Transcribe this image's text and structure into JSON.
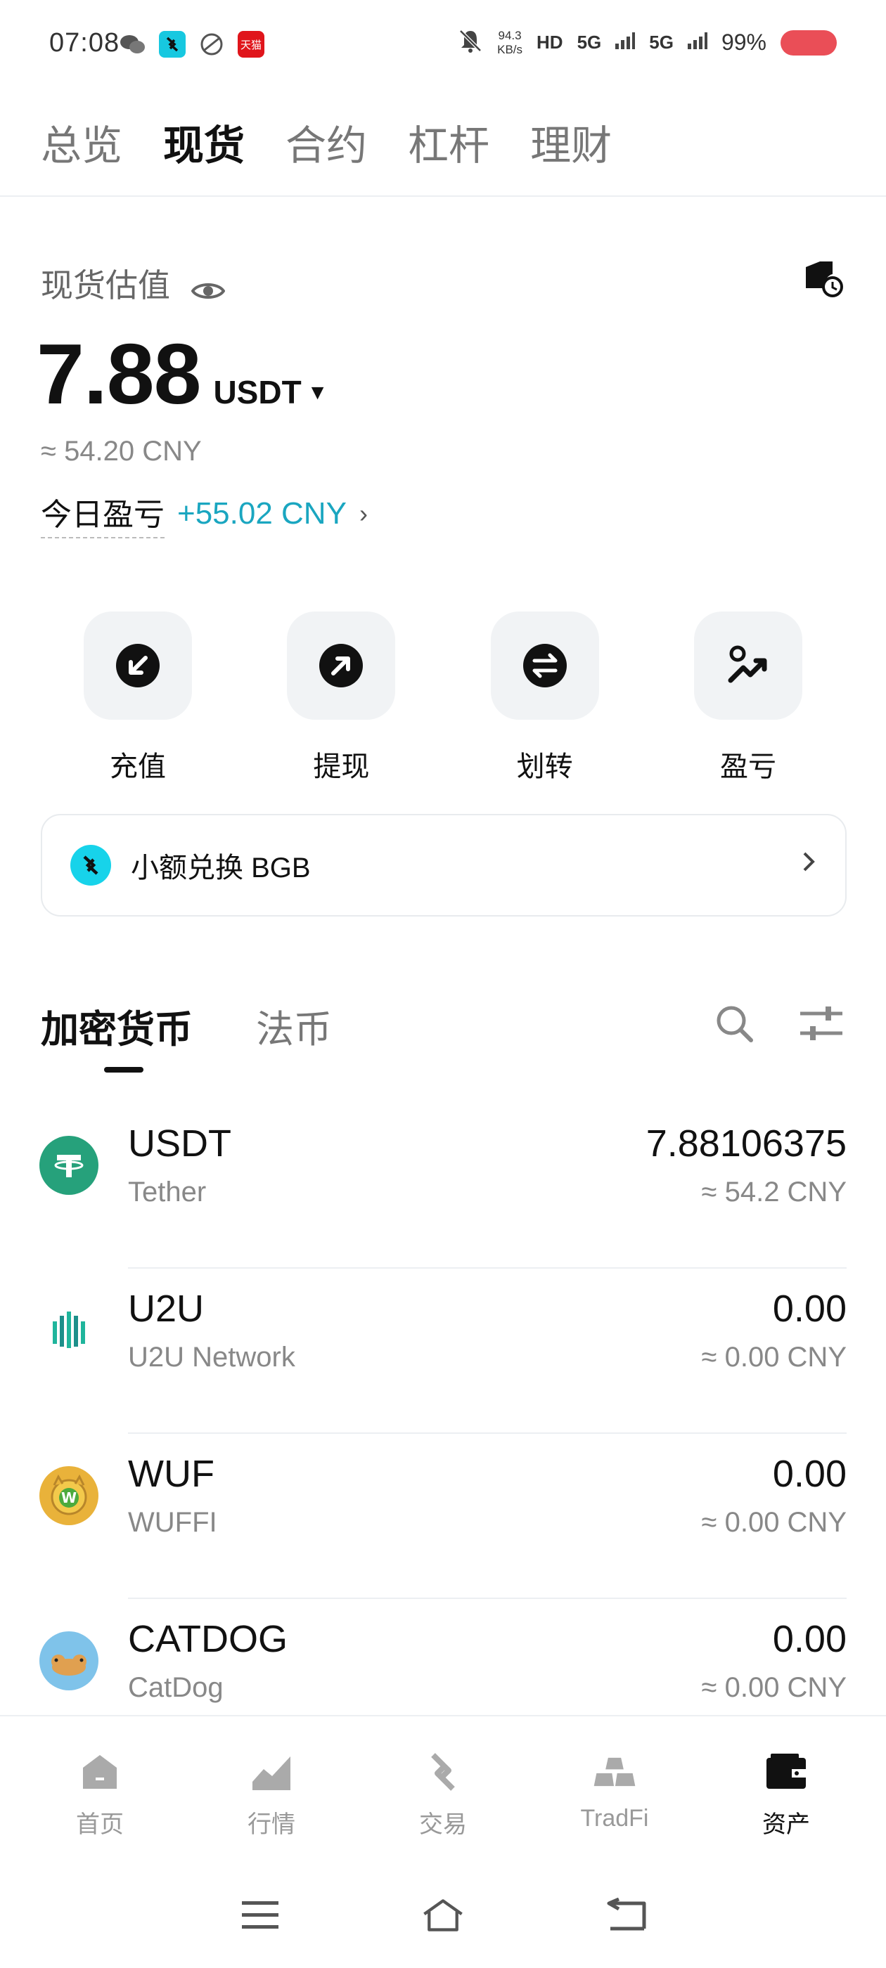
{
  "status_bar": {
    "time": "07:08",
    "net_speed_value": "94.3",
    "net_speed_unit": "KB/s",
    "hd": "HD",
    "signal1": "5G",
    "signal2": "5G",
    "battery": "99%",
    "tmall_label": "天猫"
  },
  "top_tabs": [
    {
      "label": "总览"
    },
    {
      "label": "现货"
    },
    {
      "label": "合约"
    },
    {
      "label": "杠杆"
    },
    {
      "label": "理财"
    }
  ],
  "valuation": {
    "label": "现货估值",
    "amount": "7.88",
    "currency": "USDT",
    "approx": "≈ 54.20 CNY",
    "pnl_label": "今日盈亏",
    "pnl_value": "+55.02 CNY"
  },
  "actions": [
    {
      "label": "充值"
    },
    {
      "label": "提现"
    },
    {
      "label": "划转"
    },
    {
      "label": "盈亏"
    }
  ],
  "swap_banner": {
    "text": "小额兑换 BGB"
  },
  "asset_tabs": [
    {
      "label": "加密货币"
    },
    {
      "label": "法币"
    }
  ],
  "assets": [
    {
      "symbol": "USDT",
      "name": "Tether",
      "amount": "7.88106375",
      "cny": "≈ 54.2 CNY",
      "icon": "tether-icon",
      "color": "#26a17b"
    },
    {
      "symbol": "U2U",
      "name": "U2U Network",
      "amount": "0.00",
      "cny": "≈ 0.00 CNY",
      "icon": "u2u-icon",
      "color": "#1fb59c"
    },
    {
      "symbol": "WUF",
      "name": "WUFFI",
      "amount": "0.00",
      "cny": "≈ 0.00 CNY",
      "icon": "wuffi-icon",
      "color": "#e9b23a"
    },
    {
      "symbol": "CATDOG",
      "name": "CatDog",
      "amount": "0.00",
      "cny": "≈ 0.00 CNY",
      "icon": "catdog-icon",
      "color": "#7fc3ea"
    }
  ],
  "bottom_nav": [
    {
      "label": "首页"
    },
    {
      "label": "行情"
    },
    {
      "label": "交易"
    },
    {
      "label": "TradFi"
    },
    {
      "label": "资产"
    }
  ],
  "colors": {
    "accent_teal": "#1aa6c0",
    "tile_bg": "#f1f3f5",
    "battery": "#ea4e57"
  }
}
